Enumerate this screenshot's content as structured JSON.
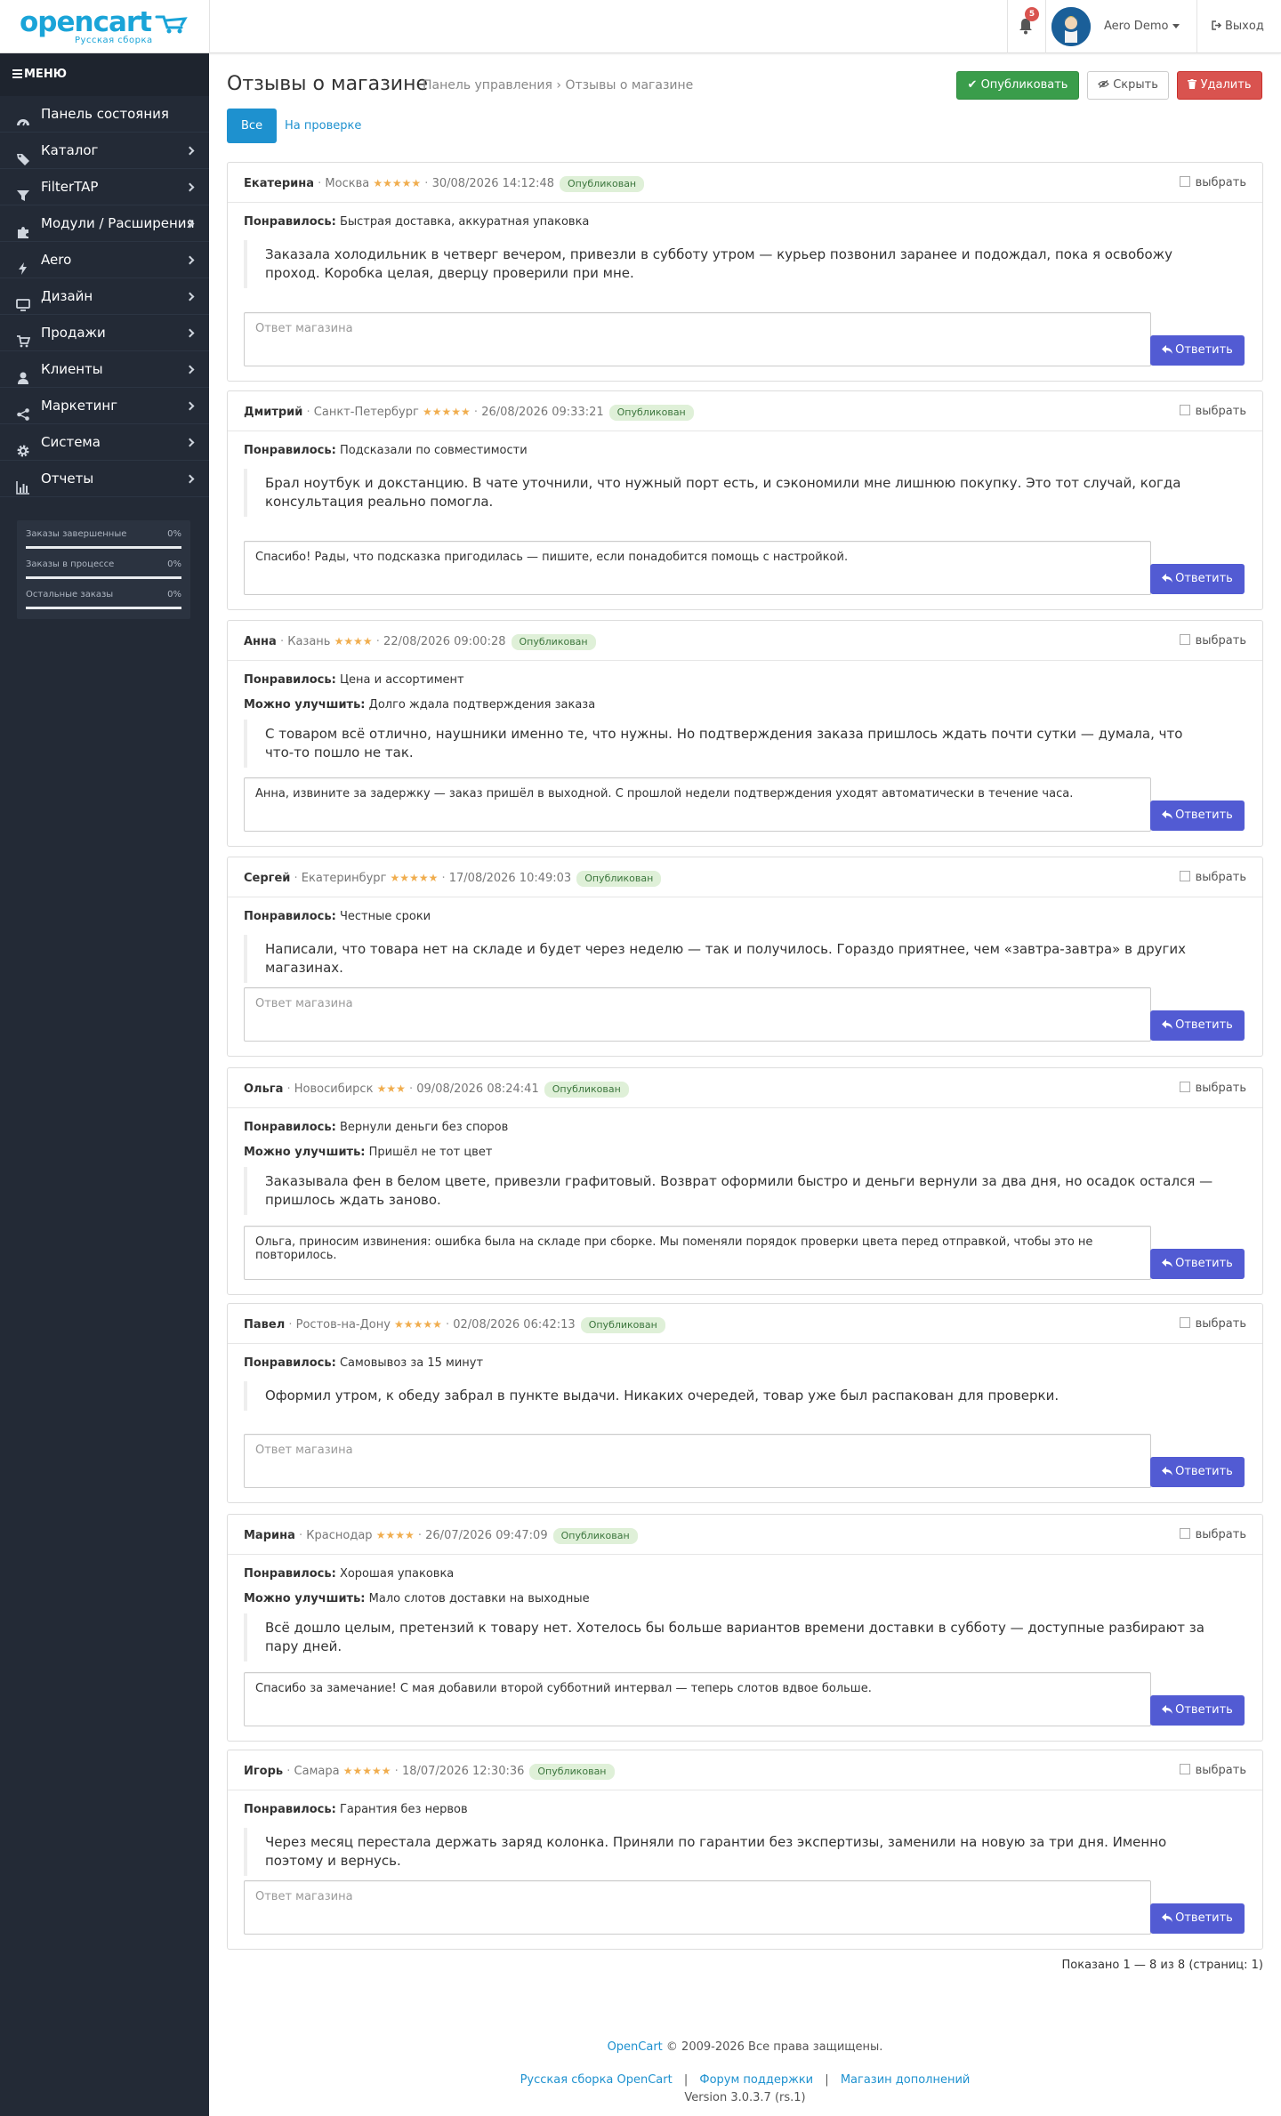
{
  "header": {
    "logo_text": "opencart",
    "logo_sub": "Русская сборка",
    "notifications_count": "5",
    "user_name": "Aero Demo",
    "logout_label": "Выход"
  },
  "sidebar": {
    "menu_label": "МЕНЮ",
    "items": [
      {
        "label": "Панель состояния",
        "icon": "dashboard-icon",
        "has_children": false
      },
      {
        "label": "Каталог",
        "icon": "tags-icon",
        "has_children": true
      },
      {
        "label": "FilterTAP",
        "icon": "filter-icon",
        "has_children": true
      },
      {
        "label": "Модули / Расширения",
        "icon": "puzzle-icon",
        "has_children": true
      },
      {
        "label": "Aero",
        "icon": "bolt-icon",
        "has_children": true
      },
      {
        "label": "Дизайн",
        "icon": "monitor-icon",
        "has_children": true
      },
      {
        "label": "Продажи",
        "icon": "cart-icon",
        "has_children": true
      },
      {
        "label": "Клиенты",
        "icon": "user-icon",
        "has_children": true
      },
      {
        "label": "Маркетинг",
        "icon": "share-icon",
        "has_children": true
      },
      {
        "label": "Система",
        "icon": "gear-icon",
        "has_children": true
      },
      {
        "label": "Отчеты",
        "icon": "bar-chart-icon",
        "has_children": true
      }
    ],
    "stats": [
      {
        "label": "Заказы завершенные",
        "pct": "0%"
      },
      {
        "label": "Заказы в процессе",
        "pct": "0%"
      },
      {
        "label": "Остальные заказы",
        "pct": "0%"
      }
    ]
  },
  "page": {
    "title": "Отзывы о магазине",
    "breadcrumb": [
      "Панель управления",
      "Отзывы о магазине"
    ],
    "buttons": {
      "publish": "Опубликовать",
      "hide": "Скрыть",
      "delete": "Удалить"
    },
    "tabs": [
      "Все",
      "На проверке"
    ],
    "select_label": "выбрать",
    "reply_label": "Ответить",
    "answer_placeholder": "Ответ магазина",
    "liked_label": "Понравилось:",
    "improve_label": "Можно улучшить:"
  },
  "reviews": [
    {
      "name": "Екатерина",
      "city": "Москва",
      "stars": "★★★★★",
      "date": "30/08/2026 14:12:48",
      "status": "Опубликован",
      "liked": "Быстрая доставка, аккуратная упаковка",
      "improve": "",
      "text": "Заказала холодильник в четверг вечером, привезли в субботу утром — курьер позвонил заранее и подождал, пока я освобожу проход. Коробка целая, дверцу проверили при мне.",
      "answer": ""
    },
    {
      "name": "Дмитрий",
      "city": "Санкт-Петербург",
      "stars": "★★★★★",
      "date": "26/08/2026 09:33:21",
      "status": "Опубликован",
      "liked": "Подсказали по совместимости",
      "improve": "",
      "text": "Брал ноутбук и докстанцию. В чате уточнили, что нужный порт есть, и сэкономили мне лишнюю покупку. Это тот случай, когда консультация реально помогла.",
      "answer": "Спасибо! Рады, что подсказка пригодилась — пишите, если понадобится помощь с настройкой."
    },
    {
      "name": "Анна",
      "city": "Казань",
      "stars": "★★★★",
      "date": "22/08/2026 09:00:28",
      "status": "Опубликован",
      "liked": "Цена и ассортимент",
      "improve": "Долго ждала подтверждения заказа",
      "text": "С товаром всё отлично, наушники именно те, что нужны. Но подтверждения заказа пришлось ждать почти сутки — думала, что что-то пошло не так.",
      "answer": "Анна, извините за задержку — заказ пришёл в выходной. С прошлой недели подтверждения уходят автоматически в течение часа."
    },
    {
      "name": "Сергей",
      "city": "Екатеринбург",
      "stars": "★★★★★",
      "date": "17/08/2026 10:49:03",
      "status": "Опубликован",
      "liked": "Честные сроки",
      "improve": "",
      "text": "Написали, что товара нет на складе и будет через неделю — так и получилось. Гораздо приятнее, чем «завтра-завтра» в других магазинах.",
      "answer": ""
    },
    {
      "name": "Ольга",
      "city": "Новосибирск",
      "stars": "★★★",
      "date": "09/08/2026 08:24:41",
      "status": "Опубликован",
      "liked": "Вернули деньги без споров",
      "improve": "Пришёл не тот цвет",
      "text": "Заказывала фен в белом цвете, привезли графитовый. Возврат оформили быстро и деньги вернули за два дня, но осадок остался — пришлось ждать заново.",
      "answer": "Ольга, приносим извинения: ошибка была на складе при сборке. Мы поменяли порядок проверки цвета перед отправкой, чтобы это не повторилось."
    },
    {
      "name": "Павел",
      "city": "Ростов-на-Дону",
      "stars": "★★★★★",
      "date": "02/08/2026 06:42:13",
      "status": "Опубликован",
      "liked": "Самовывоз за 15 минут",
      "improve": "",
      "text": "Оформил утром, к обеду забрал в пункте выдачи. Никаких очередей, товар уже был распакован для проверки.",
      "answer": ""
    },
    {
      "name": "Марина",
      "city": "Краснодар",
      "stars": "★★★★",
      "date": "26/07/2026 09:47:09",
      "status": "Опубликован",
      "liked": "Хорошая упаковка",
      "improve": "Мало слотов доставки на выходные",
      "text": "Всё дошло целым, претензий к товару нет. Хотелось бы больше вариантов времени доставки в субботу — доступные разбирают за пару дней.",
      "answer": "Спасибо за замечание! С мая добавили второй субботний интервал — теперь слотов вдвое больше."
    },
    {
      "name": "Игорь",
      "city": "Самара",
      "stars": "★★★★★",
      "date": "18/07/2026 12:30:36",
      "status": "Опубликован",
      "liked": "Гарантия без нервов",
      "improve": "",
      "text": "Через месяц перестала держать заряд колонка. Приняли по гарантии без экспертизы, заменили на новую за три дня. Именно поэтому и вернусь.",
      "answer": ""
    }
  ],
  "pagination": "Показано 1 — 8 из 8 (страниц: 1)",
  "footer": {
    "brand": "OpenCart",
    "copyright": "© 2009-2026 Все права защищены.",
    "links": [
      "Русская сборка OpenCart",
      "Форум поддержки",
      "Магазин дополнений"
    ],
    "separator": "|",
    "version": "Version 3.0.3.7 (rs.1)"
  },
  "colors": {
    "sidebar_bg": "#232a36",
    "accent_blue": "#1e91cf",
    "publish_green": "#3a9d4b",
    "delete_red": "#d9534f",
    "reply_indigo": "#525bd3",
    "star_orange": "#f0ad4e"
  }
}
